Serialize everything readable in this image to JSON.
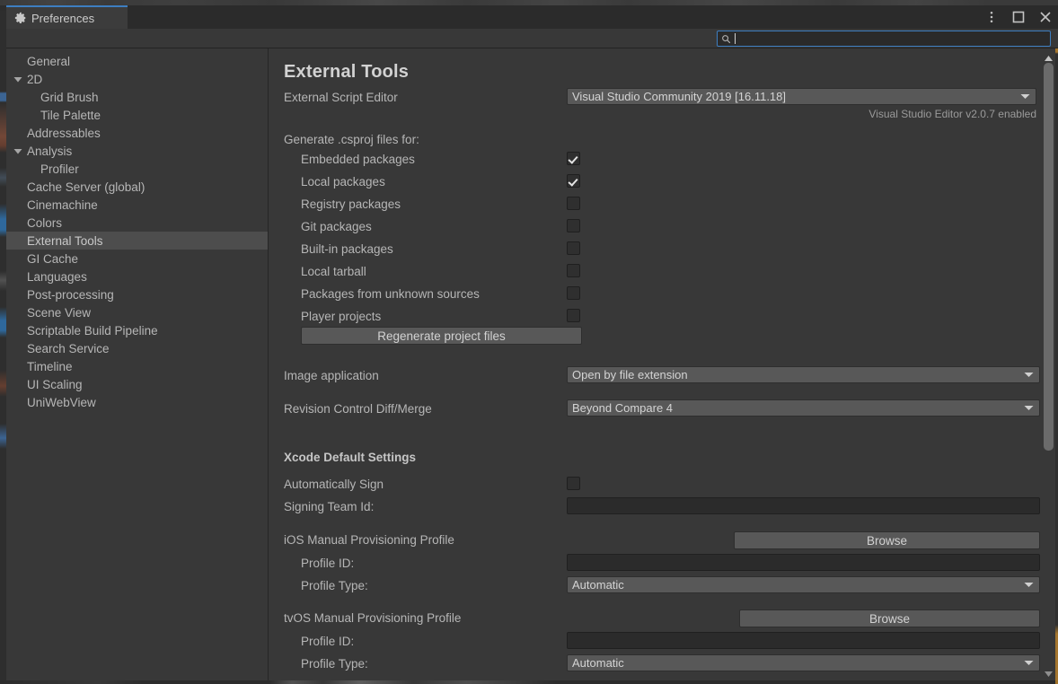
{
  "window": {
    "tab_label": "Preferences",
    "tab_icon": "gear-icon",
    "menu_icon": "kebab-menu-icon",
    "maximize_icon": "maximize-icon",
    "close_icon": "close-icon",
    "accent_color": "#3d7ec1",
    "background_color": "#383838"
  },
  "search": {
    "icon": "search-icon",
    "value": "",
    "placeholder": ""
  },
  "sidebar": {
    "items": [
      {
        "label": "General",
        "indent": 0,
        "arrow": "none",
        "selected": false
      },
      {
        "label": "2D",
        "indent": 0,
        "arrow": "expanded",
        "selected": false
      },
      {
        "label": "Grid Brush",
        "indent": 1,
        "arrow": "none",
        "selected": false
      },
      {
        "label": "Tile Palette",
        "indent": 1,
        "arrow": "none",
        "selected": false
      },
      {
        "label": "Addressables",
        "indent": 0,
        "arrow": "none",
        "selected": false
      },
      {
        "label": "Analysis",
        "indent": 0,
        "arrow": "expanded",
        "selected": false
      },
      {
        "label": "Profiler",
        "indent": 1,
        "arrow": "none",
        "selected": false
      },
      {
        "label": "Cache Server (global)",
        "indent": 0,
        "arrow": "none",
        "selected": false
      },
      {
        "label": "Cinemachine",
        "indent": 0,
        "arrow": "none",
        "selected": false
      },
      {
        "label": "Colors",
        "indent": 0,
        "arrow": "none",
        "selected": false
      },
      {
        "label": "External Tools",
        "indent": 0,
        "arrow": "none",
        "selected": true
      },
      {
        "label": "GI Cache",
        "indent": 0,
        "arrow": "none",
        "selected": false
      },
      {
        "label": "Languages",
        "indent": 0,
        "arrow": "none",
        "selected": false
      },
      {
        "label": "Post-processing",
        "indent": 0,
        "arrow": "none",
        "selected": false
      },
      {
        "label": "Scene View",
        "indent": 0,
        "arrow": "none",
        "selected": false
      },
      {
        "label": "Scriptable Build Pipeline",
        "indent": 0,
        "arrow": "none",
        "selected": false
      },
      {
        "label": "Search Service",
        "indent": 0,
        "arrow": "none",
        "selected": false
      },
      {
        "label": "Timeline",
        "indent": 0,
        "arrow": "none",
        "selected": false
      },
      {
        "label": "UI Scaling",
        "indent": 0,
        "arrow": "none",
        "selected": false
      },
      {
        "label": "UniWebView",
        "indent": 0,
        "arrow": "none",
        "selected": false
      }
    ]
  },
  "content": {
    "title": "External Tools",
    "script_editor": {
      "label": "External Script Editor",
      "value": "Visual Studio Community 2019 [16.11.18]",
      "note": "Visual Studio Editor v2.0.7 enabled"
    },
    "csproj": {
      "label": "Generate .csproj files for:",
      "options": [
        {
          "label": "Embedded packages",
          "checked": true
        },
        {
          "label": "Local packages",
          "checked": true
        },
        {
          "label": "Registry packages",
          "checked": false
        },
        {
          "label": "Git packages",
          "checked": false
        },
        {
          "label": "Built-in packages",
          "checked": false
        },
        {
          "label": "Local tarball",
          "checked": false
        },
        {
          "label": "Packages from unknown sources",
          "checked": false
        },
        {
          "label": "Player projects",
          "checked": false
        }
      ],
      "regenerate_button": "Regenerate project files"
    },
    "image_application": {
      "label": "Image application",
      "value": "Open by file extension"
    },
    "diff_merge": {
      "label": "Revision Control Diff/Merge",
      "value": "Beyond Compare 4"
    },
    "xcode": {
      "heading": "Xcode Default Settings",
      "auto_sign": {
        "label": "Automatically Sign",
        "checked": false
      },
      "signing_team_id": {
        "label": "Signing Team Id:",
        "value": ""
      },
      "ios": {
        "label": "iOS Manual Provisioning Profile",
        "browse_button": "Browse",
        "profile_id": {
          "label": "Profile ID:",
          "value": ""
        },
        "profile_type": {
          "label": "Profile Type:",
          "value": "Automatic"
        }
      },
      "tvos": {
        "label": "tvOS Manual Provisioning Profile",
        "browse_button": "Browse",
        "profile_id": {
          "label": "Profile ID:",
          "value": ""
        },
        "profile_type": {
          "label": "Profile Type:",
          "value": "Automatic"
        }
      }
    }
  },
  "scrollbar": {
    "up_icon": "scroll-up-arrow-icon",
    "down_icon": "scroll-down-arrow-icon"
  }
}
